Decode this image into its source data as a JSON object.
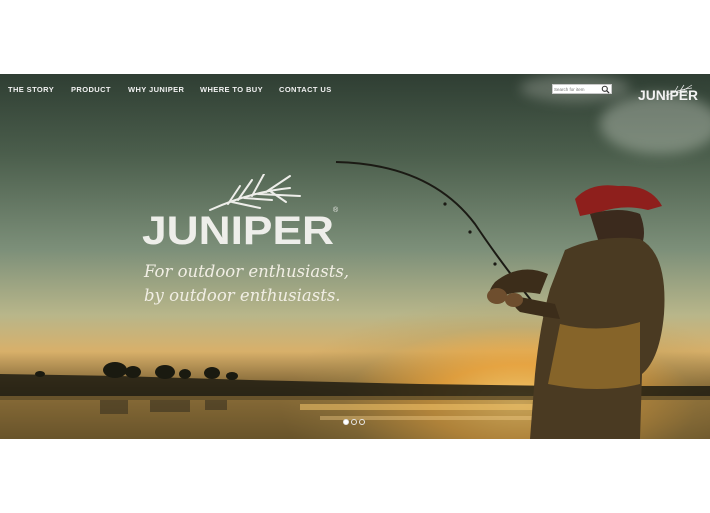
{
  "nav": {
    "items": [
      {
        "label": "THE STORY"
      },
      {
        "label": "PRODUCT"
      },
      {
        "label": "WHY JUNIPER"
      },
      {
        "label": "WHERE TO BUY"
      },
      {
        "label": "CONTACT US"
      }
    ]
  },
  "search": {
    "placeholder": "Search for item"
  },
  "brand": {
    "name": "JUNIPER",
    "registered": "®"
  },
  "hero": {
    "tagline_line1": "For outdoor enthusiasts,",
    "tagline_line2": "by outdoor enthusiasts."
  },
  "carousel": {
    "count": 3,
    "active_index": 0
  },
  "icons": {
    "search": "search-icon",
    "logo_branch": "juniper-branch-icon"
  },
  "colors": {
    "nav_text": "#f2f2f2",
    "tagline": "#f1eee4",
    "sun": "#ffd678"
  }
}
